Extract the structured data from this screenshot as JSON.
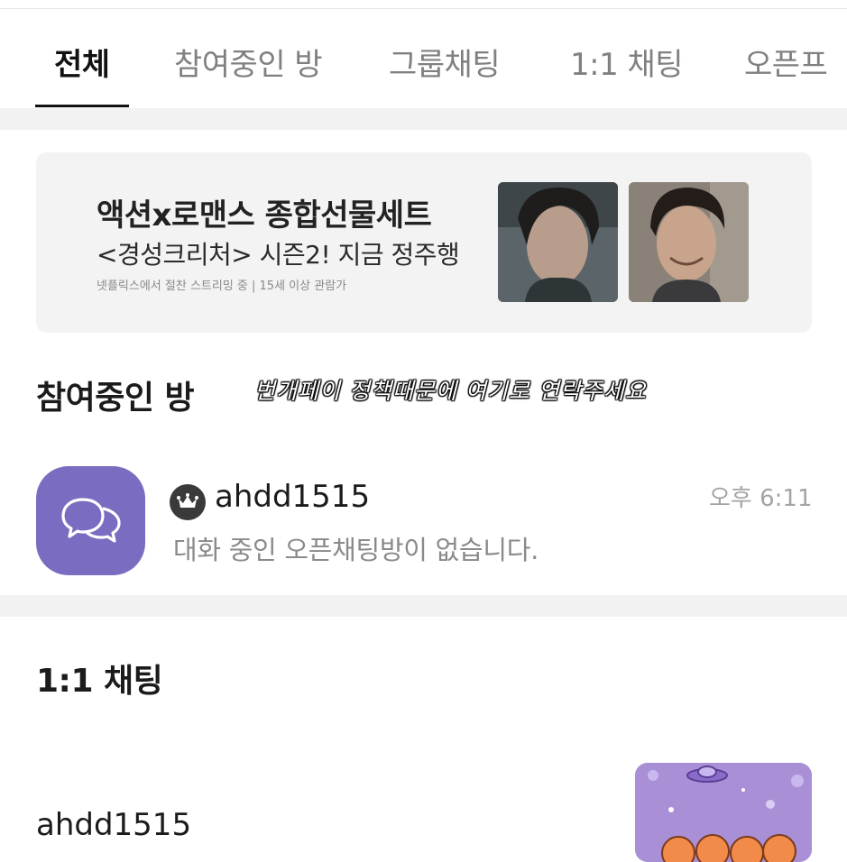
{
  "tabs": [
    {
      "label": "전체",
      "active": true
    },
    {
      "label": "참여중인 방",
      "active": false
    },
    {
      "label": "그룹채팅",
      "active": false
    },
    {
      "label": "1:1 채팅",
      "active": false
    },
    {
      "label": "오픈프",
      "active": false
    }
  ],
  "banner": {
    "title": "액션x로맨스 종합선물세트",
    "subtitle": "<경성크리처> 시즌2! 지금 정주행",
    "note": "넷플릭스에서 절찬 스트리밍 중 | 15세 이상 관람가"
  },
  "joined_section": {
    "title": "참여중인 방",
    "handwritten_note": "번개페이 정책때문에 여기로 연락주세요",
    "room": {
      "name": "ahdd1515",
      "time": "오후 6:11",
      "message": "대화 중인 오픈채팅방이 없습니다."
    }
  },
  "dm_section": {
    "title": "1:1 채팅",
    "item": {
      "name": "ahdd1515"
    }
  },
  "colors": {
    "room_icon": "#7a6cc0",
    "active_tab": "#111111",
    "inactive_tab": "#808080"
  }
}
